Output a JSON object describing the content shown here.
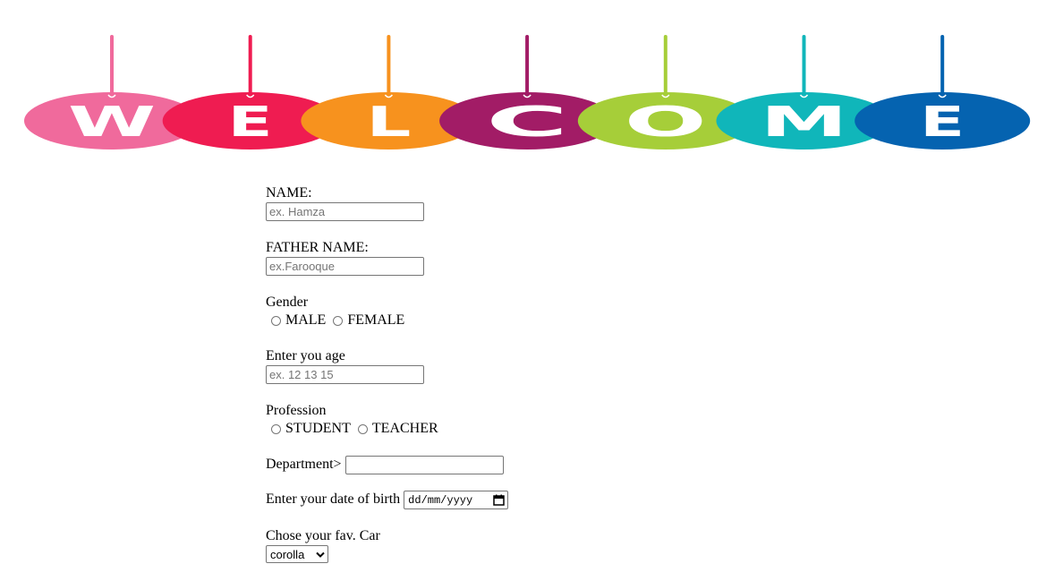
{
  "banner": {
    "letters": [
      "W",
      "E",
      "L",
      "C",
      "O",
      "M",
      "E"
    ],
    "colors": [
      "#F06A9C",
      "#EF1C51",
      "#F7921E",
      "#A21C66",
      "#A6CE39",
      "#10B6BA",
      "#0563B0"
    ]
  },
  "form": {
    "name_label": "NAME:",
    "name_placeholder": "ex. Hamza",
    "father_label": "FATHER NAME:",
    "father_placeholder": "ex.Farooque",
    "gender_label": "Gender",
    "gender_options": [
      "MALE",
      "FEMALE"
    ],
    "age_label": "Enter you age",
    "age_placeholder": "ex. 12 13 15",
    "profession_label": "Profession",
    "profession_options": [
      "STUDENT",
      "TEACHER"
    ],
    "department_label": "Department>",
    "department_value": "",
    "dob_label": "Enter your date of birth",
    "dob_placeholder": "dd/mm/yyyy",
    "car_label": "Chose your fav. Car",
    "car_selected": "corolla"
  }
}
